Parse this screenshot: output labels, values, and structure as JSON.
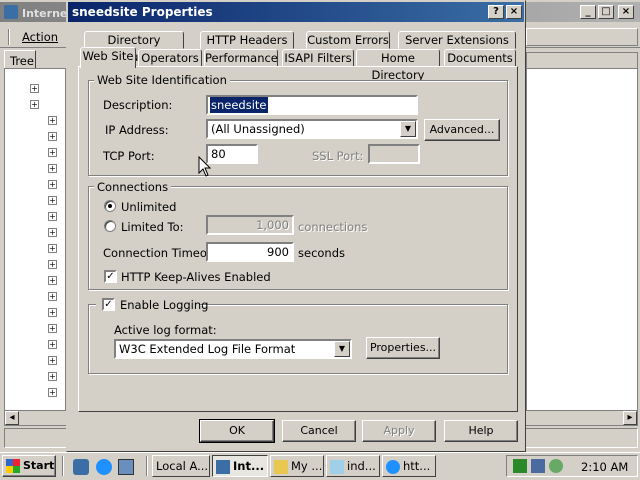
{
  "background_window": {
    "title": "Interne",
    "menu_action": "Action",
    "tab_tree": "Tree"
  },
  "dialog": {
    "title": "sneedsite Properties",
    "help_icon": "?",
    "close_icon": "×",
    "tabs_back": [
      "Directory Security",
      "HTTP Headers",
      "Custom Errors",
      "Server Extensions"
    ],
    "tabs_front": [
      "Web Site",
      "Operators",
      "Performance",
      "ISAPI Filters",
      "Home Directory",
      "Documents"
    ],
    "active_tab": "Web Site",
    "identification": {
      "legend": "Web Site Identification",
      "description_label": "Description:",
      "description_value": "sneedsite",
      "ip_label": "IP Address:",
      "ip_value": "(All Unassigned)",
      "advanced_button": "Advanced...",
      "tcp_label": "TCP Port:",
      "tcp_value": "80",
      "ssl_label": "SSL Port:",
      "ssl_value": ""
    },
    "connections": {
      "legend": "Connections",
      "unlimited_label": "Unlimited",
      "unlimited_selected": true,
      "limited_label": "Limited To:",
      "limited_value": "1,000",
      "limited_unit": "connections",
      "timeout_label": "Connection Timeout:",
      "timeout_value": "900",
      "timeout_unit": "seconds",
      "keepalive_label": "HTTP Keep-Alives Enabled",
      "keepalive_checked": true
    },
    "logging": {
      "enable_label": "Enable Logging",
      "enable_checked": true,
      "format_label": "Active log format:",
      "format_value": "W3C Extended Log File Format",
      "properties_button": "Properties..."
    },
    "buttons": {
      "ok": "OK",
      "cancel": "Cancel",
      "apply": "Apply",
      "help": "Help"
    }
  },
  "taskbar": {
    "start_label": "Start",
    "tasks": [
      "Local A...",
      "Int...",
      "My ...",
      "ind...",
      "htt..."
    ],
    "active_task": "Int...",
    "clock": "2:10 AM"
  },
  "colors": {
    "title_active": "#0a246a",
    "title_gradient_end": "#3a6ea5",
    "face": "#d4d0c8",
    "selection": "#0a246a"
  }
}
